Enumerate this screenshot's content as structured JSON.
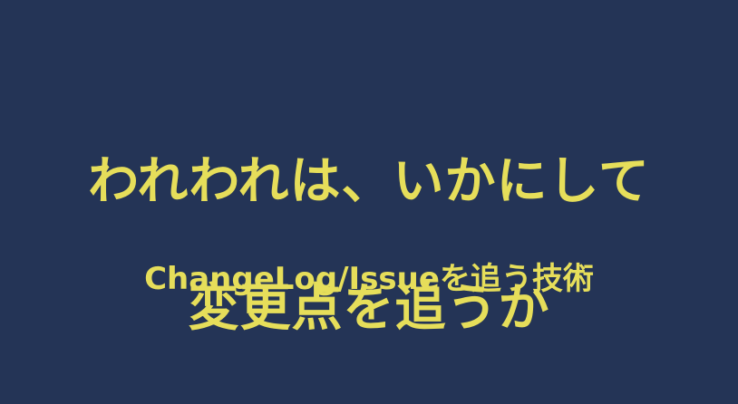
{
  "slide": {
    "title_line1": "われわれは、いかにして",
    "title_line2": "変更点を追うか",
    "subtitle": "ChangeLog/Issueを追う技術"
  },
  "colors": {
    "background": "#243456",
    "text": "#e6de5a"
  }
}
